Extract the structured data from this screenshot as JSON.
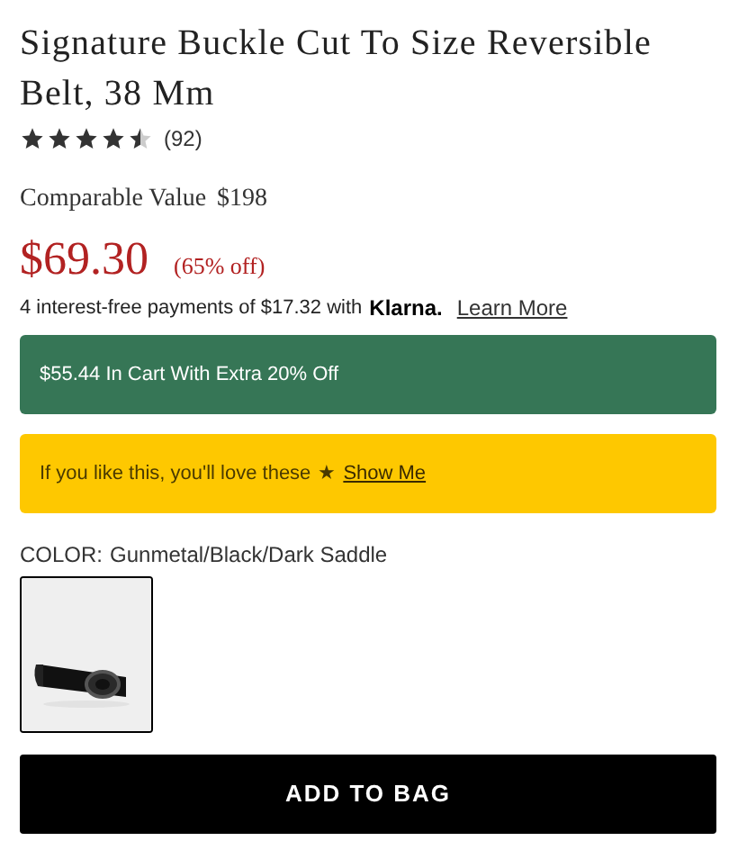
{
  "product": {
    "title": "Signature Buckle Cut To Size Reversible Belt, 38 Mm",
    "stars": 4.5,
    "review_count": "(92)"
  },
  "comparable": {
    "label": "Comparable Value",
    "value": "$198"
  },
  "price": {
    "current": "$69.30",
    "discount": "(65% off)"
  },
  "installments": {
    "text": "4 interest-free payments of $17.32 with",
    "brand": "Klarna.",
    "link": "Learn More"
  },
  "promo_banner": {
    "text": "$55.44 In Cart With Extra 20% Off"
  },
  "recommend_banner": {
    "text": "If you like this, you'll love these",
    "icon": "★",
    "link": "Show Me"
  },
  "color": {
    "label": "COLOR:",
    "value": "Gunmetal/Black/Dark Saddle",
    "swatches": [
      {
        "kind": "picture",
        "selected": true
      }
    ]
  },
  "add_button": "ADD TO BAG"
}
